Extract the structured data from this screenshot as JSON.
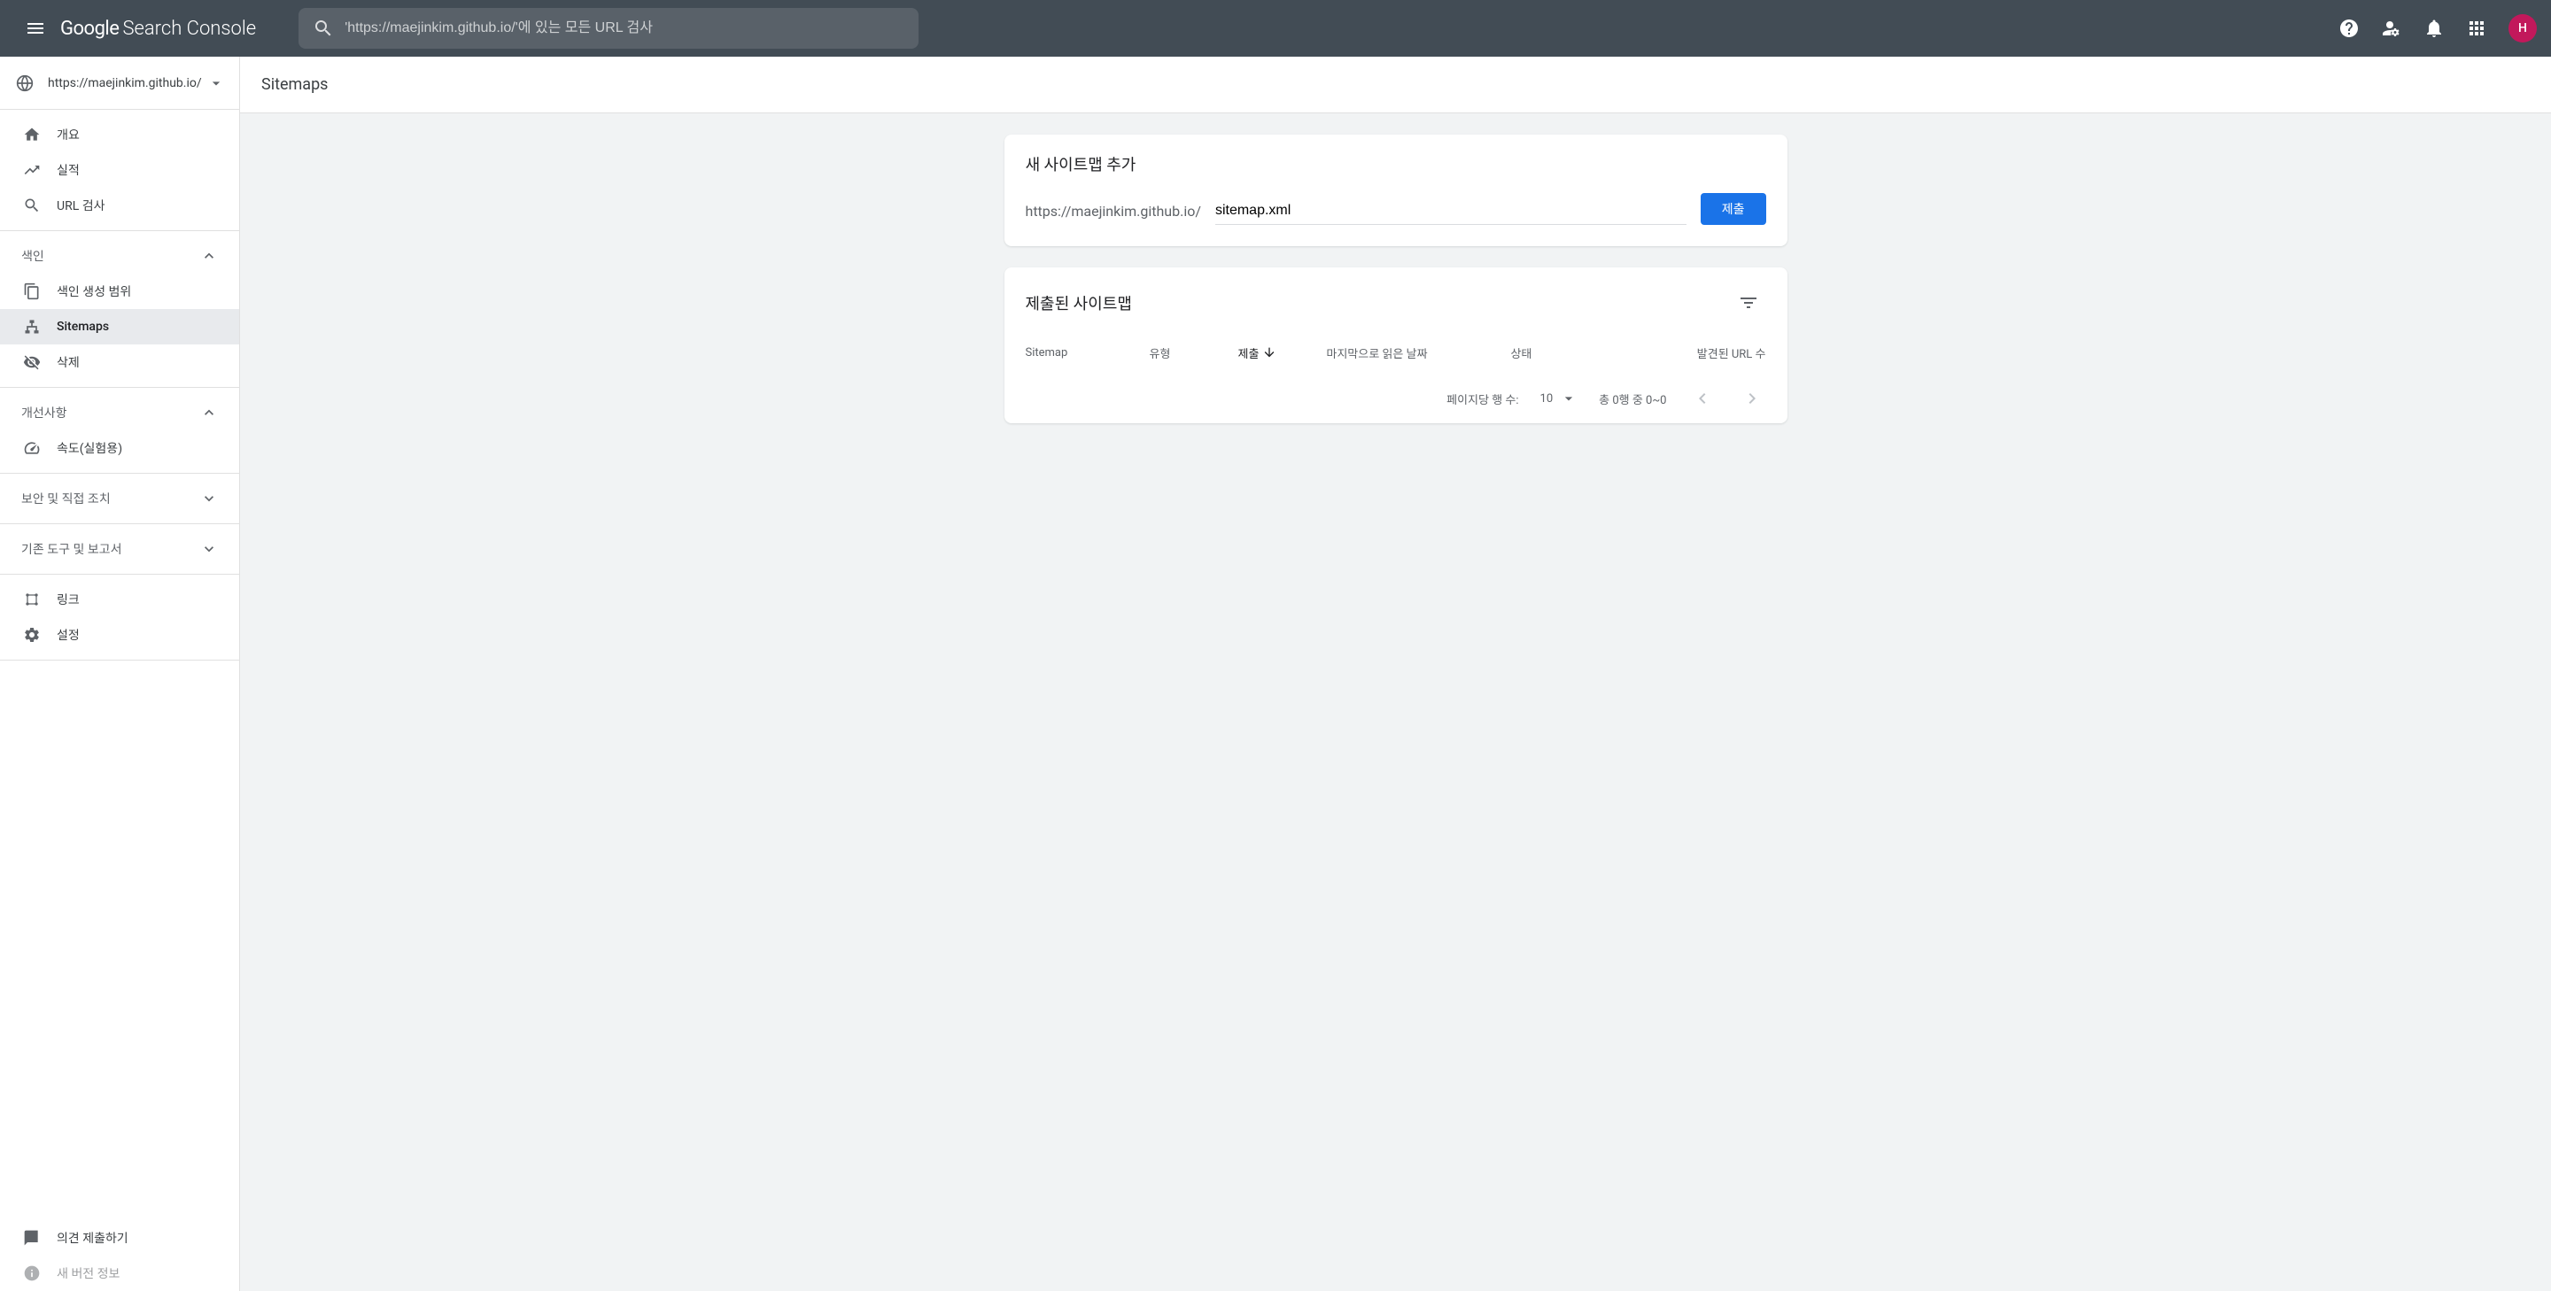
{
  "header": {
    "logo_google": "Google",
    "logo_sc": "Search Console",
    "search_placeholder": "'https://maejinkim.github.io/'에 있는 모든 URL 검사",
    "avatar_initial": "H"
  },
  "sidebar": {
    "property": "https://maejinkim.github.io/",
    "nav_top": [
      {
        "label": "개요"
      },
      {
        "label": "실적"
      },
      {
        "label": "URL 검사"
      }
    ],
    "section_index": "색인",
    "nav_index": [
      {
        "label": "색인 생성 범위"
      },
      {
        "label": "Sitemaps"
      },
      {
        "label": "삭제"
      }
    ],
    "section_enhance": "개선사항",
    "nav_enhance": [
      {
        "label": "속도(실험용)"
      }
    ],
    "section_security": "보안 및 직접 조치",
    "section_legacy": "기존 도구 및 보고서",
    "nav_bottom": [
      {
        "label": "링크"
      },
      {
        "label": "설정"
      }
    ],
    "feedback": "의견 제출하기",
    "publisher": "새 버전 정보"
  },
  "main": {
    "page_title": "Sitemaps",
    "add_card": {
      "title": "새 사이트맵 추가",
      "url_prefix": "https://maejinkim.github.io/",
      "input_value": "sitemap.xml",
      "submit": "제출"
    },
    "list_card": {
      "title": "제출된 사이트맵",
      "columns": {
        "sitemap": "Sitemap",
        "type": "유형",
        "submitted": "제출",
        "last_read": "마지막으로 읽은 날짜",
        "status": "상태",
        "discovered": "발견된 URL 수"
      },
      "footer": {
        "rows_label": "페이지당 행 수:",
        "rows_value": "10",
        "range": "총 0행 중 0~0"
      }
    }
  }
}
